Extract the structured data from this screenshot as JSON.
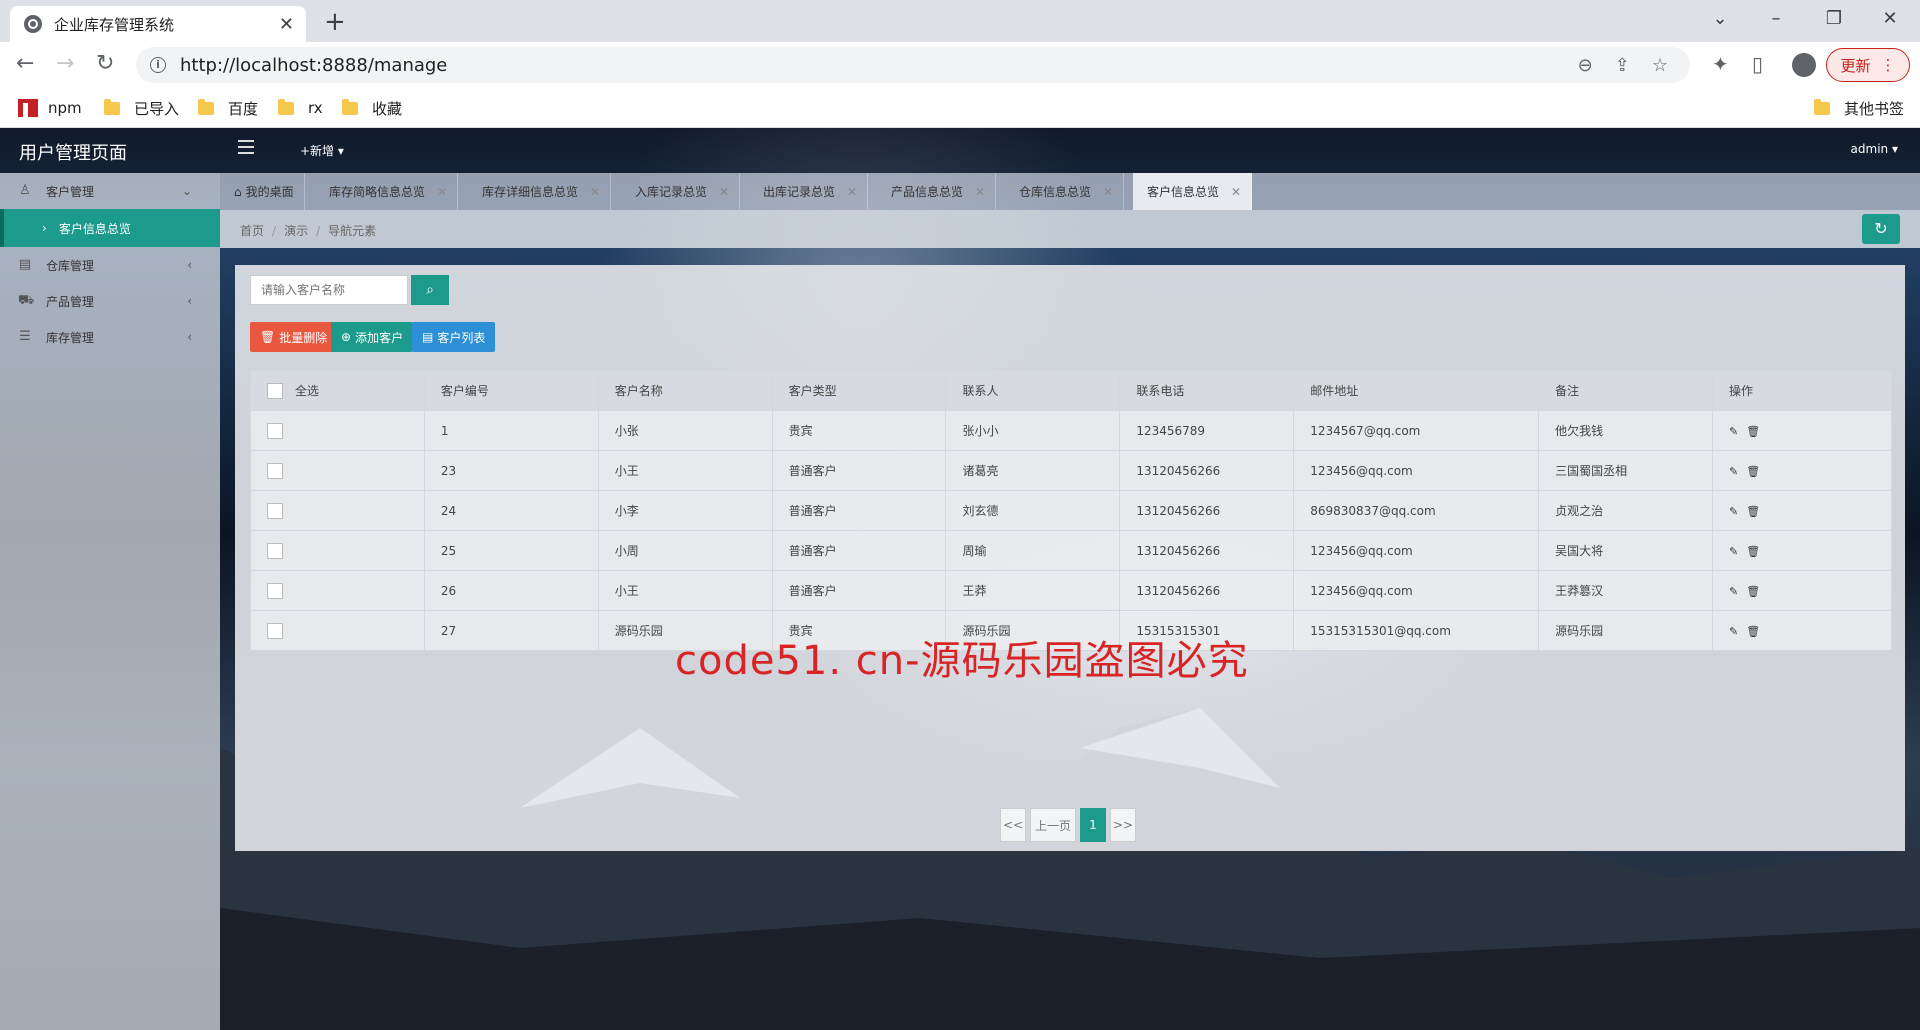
{
  "browser": {
    "tab_title": "企业库存管理系统",
    "url": "http://localhost:8888/manage",
    "update_label": "更新",
    "bookmarks": [
      "npm",
      "已导入",
      "百度",
      "rx",
      "收藏"
    ],
    "other_bookmarks": "其他书签"
  },
  "app": {
    "title": "用户管理页面",
    "new_menu": "+新增",
    "user": "admin"
  },
  "sidebar": {
    "items": [
      {
        "label": "客户管理",
        "icon": "user-icon"
      },
      {
        "label": "仓库管理",
        "icon": "warehouse-icon"
      },
      {
        "label": "产品管理",
        "icon": "cart-icon"
      },
      {
        "label": "库存管理",
        "icon": "database-icon"
      }
    ],
    "sub_item": "客户信息总览"
  },
  "tabs": [
    "我的桌面",
    "库存简略信息总览",
    "库存详细信息总览",
    "入库记录总览",
    "出库记录总览",
    "产品信息总览",
    "仓库信息总览",
    "客户信息总览"
  ],
  "breadcrumb": [
    "首页",
    "演示",
    "导航元素"
  ],
  "toolbar": {
    "search_placeholder": "请输入客户名称",
    "batch_delete": "批量删除",
    "add_customer": "添加客户",
    "customer_list": "客户列表"
  },
  "table": {
    "headers": [
      "全选",
      "客户编号",
      "客户名称",
      "客户类型",
      "联系人",
      "联系电话",
      "邮件地址",
      "备注",
      "操作"
    ],
    "rows": [
      [
        "1",
        "小张",
        "贵宾",
        "张小小",
        "123456789",
        "1234567@qq.com",
        "他欠我钱"
      ],
      [
        "23",
        "小王",
        "普通客户",
        "诸葛亮",
        "13120456266",
        "123456@qq.com",
        "三国蜀国丞相"
      ],
      [
        "24",
        "小李",
        "普通客户",
        "刘玄德",
        "13120456266",
        "869830837@qq.com",
        "贞观之治"
      ],
      [
        "25",
        "小周",
        "普通客户",
        "周瑜",
        "13120456266",
        "123456@qq.com",
        "吴国大将"
      ],
      [
        "26",
        "小王",
        "普通客户",
        "王莽",
        "13120456266",
        "123456@qq.com",
        "王莽篡汉"
      ],
      [
        "27",
        "源码乐园",
        "贵宾",
        "源码乐园",
        "15315315301",
        "15315315301@qq.com",
        "源码乐园"
      ]
    ]
  },
  "pager": {
    "first": "<<",
    "prev": "上一页",
    "current": "1",
    "last": ">>"
  },
  "watermark": "code51. cn-源码乐园盗图必究",
  "colors": {
    "accent": "#1c9a8b",
    "danger": "#e9573f",
    "info": "#2d8fd6"
  }
}
